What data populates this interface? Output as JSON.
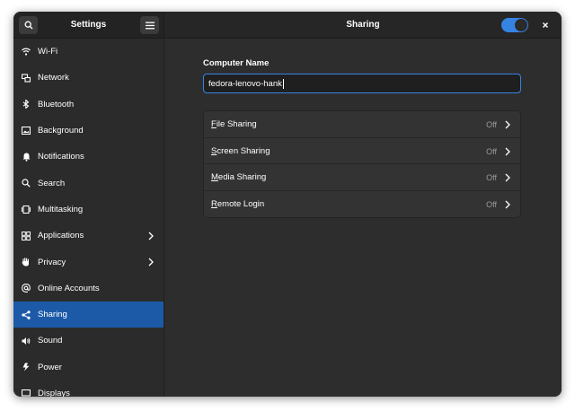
{
  "sidebar": {
    "title": "Settings",
    "items": [
      {
        "label": "Wi-Fi",
        "icon": "wifi-icon"
      },
      {
        "label": "Network",
        "icon": "network-icon"
      },
      {
        "label": "Bluetooth",
        "icon": "bluetooth-icon"
      },
      {
        "label": "Background",
        "icon": "background-icon"
      },
      {
        "label": "Notifications",
        "icon": "bell-icon"
      },
      {
        "label": "Search",
        "icon": "search-icon"
      },
      {
        "label": "Multitasking",
        "icon": "multitasking-icon"
      },
      {
        "label": "Applications",
        "icon": "applications-icon",
        "chevron": true
      },
      {
        "label": "Privacy",
        "icon": "hand-icon",
        "chevron": true
      },
      {
        "label": "Online Accounts",
        "icon": "at-icon"
      },
      {
        "label": "Sharing",
        "icon": "share-icon",
        "active": true
      },
      {
        "label": "Sound",
        "icon": "speaker-icon"
      },
      {
        "label": "Power",
        "icon": "power-icon"
      },
      {
        "label": "Displays",
        "icon": "display-icon"
      }
    ]
  },
  "main": {
    "title": "Sharing",
    "sharing_enabled": true,
    "computer_name": {
      "label": "Computer Name",
      "value": "fedora-lenovo-hank"
    },
    "services": [
      {
        "first": "F",
        "rest": "ile Sharing",
        "status": "Off"
      },
      {
        "first": "S",
        "rest": "creen Sharing",
        "status": "Off"
      },
      {
        "first": "M",
        "rest": "edia Sharing",
        "status": "Off"
      },
      {
        "first": "R",
        "rest": "emote Login",
        "status": "Off"
      }
    ]
  },
  "colors": {
    "accent": "#3584e4",
    "sidebar_active": "#1c5aa8",
    "background": "#2d2d2d"
  }
}
